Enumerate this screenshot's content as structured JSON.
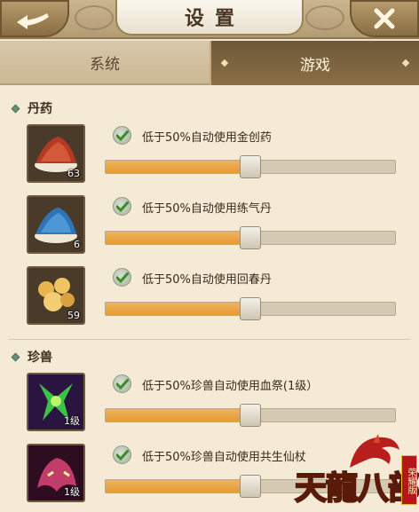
{
  "header": {
    "title": "设置"
  },
  "tabs": [
    {
      "label": "系统",
      "active": false
    },
    {
      "label": "游戏",
      "active": true
    }
  ],
  "sections": {
    "medicine": {
      "title": "丹药",
      "items": [
        {
          "label": "低于50%自动使用金创药",
          "count": "63",
          "icon": "red-powder-icon",
          "checked": true,
          "slider_fraction": 0.5
        },
        {
          "label": "低于50%自动使用练气丹",
          "count": "6",
          "icon": "blue-powder-icon",
          "checked": true,
          "slider_fraction": 0.5
        },
        {
          "label": "低于50%自动使用回春丹",
          "count": "59",
          "icon": "golden-pills-icon",
          "checked": true,
          "slider_fraction": 0.5
        }
      ]
    },
    "pet": {
      "title": "珍兽",
      "items": [
        {
          "label": "低于50%珍兽自动使用血祭(1级）",
          "count": "1级",
          "icon": "green-skill-icon",
          "checked": true,
          "slider_fraction": 0.5
        },
        {
          "label": "低于50%珍兽自动使用共生仙杖",
          "count": "1级",
          "icon": "beast-skill-icon",
          "checked": true,
          "slider_fraction": 0.5
        }
      ]
    }
  },
  "logo": {
    "text": "天龍八部",
    "tag": "荣耀版"
  },
  "colors": {
    "slider_fill": "#e9a23f",
    "active_tab": "#7a6240",
    "check_mark": "#3f8a2c"
  }
}
